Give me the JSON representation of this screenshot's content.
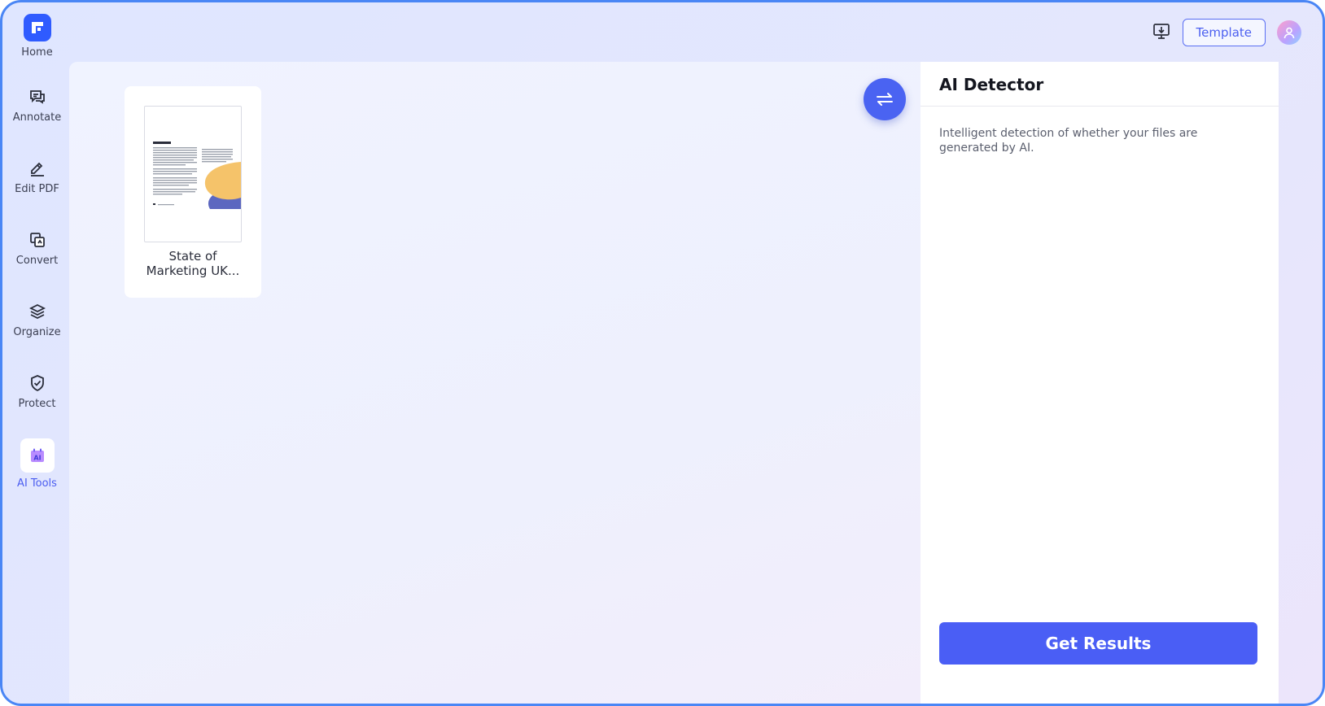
{
  "sidebar": {
    "items": [
      {
        "label": "Home",
        "icon": "home-logo-icon"
      },
      {
        "label": "Annotate",
        "icon": "annotate-icon"
      },
      {
        "label": "Edit PDF",
        "icon": "edit-pdf-icon"
      },
      {
        "label": "Convert",
        "icon": "convert-icon"
      },
      {
        "label": "Organize",
        "icon": "organize-icon"
      },
      {
        "label": "Protect",
        "icon": "protect-icon"
      },
      {
        "label": "AI Tools",
        "icon": "ai-tools-icon",
        "active": true
      }
    ]
  },
  "topbar": {
    "template_label": "Template",
    "download_icon": "desktop-download-icon",
    "avatar_icon": "user-avatar-icon"
  },
  "workspace": {
    "file": {
      "name_line1": "State of",
      "name_line2": "Marketing UK..."
    },
    "swap_icon": "swap-arrows-icon"
  },
  "panel": {
    "title": "AI Detector",
    "description": "Intelligent detection of whether your files are generated by AI.",
    "button_label": "Get Results"
  },
  "colors": {
    "accent": "#4a5ef5",
    "frame_border": "#4a86f5",
    "active_label": "#4a5cf0"
  }
}
